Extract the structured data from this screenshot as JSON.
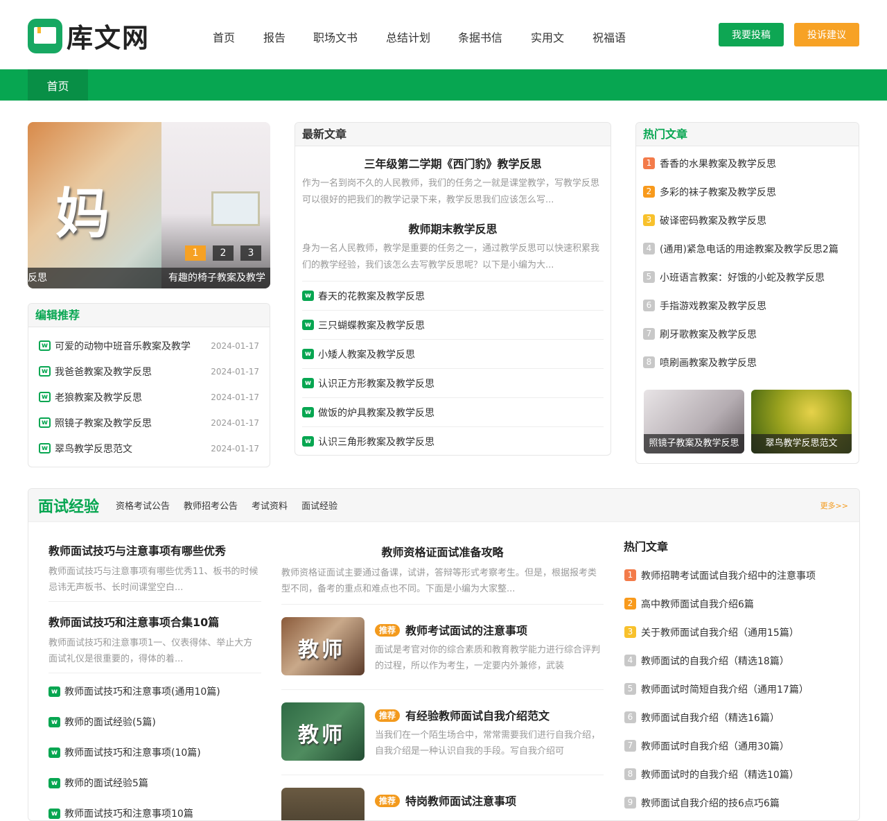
{
  "site": {
    "logo": "库文网"
  },
  "nav": [
    "首页",
    "报告",
    "职场文书",
    "总结计划",
    "条据书信",
    "实用文",
    "祝福语"
  ],
  "buttons": {
    "submit": "我要投稿",
    "feedback": "投诉建议"
  },
  "greenbar": {
    "active": "首页"
  },
  "slider": {
    "image_text": "妈",
    "captions": [
      "反思",
      "有趣的椅子教案及教学"
    ],
    "dots": [
      "1",
      "2",
      "3"
    ],
    "active_dot": 1
  },
  "editor": {
    "title": "编辑推荐",
    "items": [
      {
        "title": "可爱的动物中班音乐教案及教学",
        "date": "2024-01-17"
      },
      {
        "title": "我爸爸教案及教学反思",
        "date": "2024-01-17"
      },
      {
        "title": "老狼教案及教学反思",
        "date": "2024-01-17"
      },
      {
        "title": "照镜子教案及教学反思",
        "date": "2024-01-17"
      },
      {
        "title": "翠鸟教学反思范文",
        "date": "2024-01-17"
      }
    ]
  },
  "latest": {
    "title": "最新文章",
    "featured": [
      {
        "title": "三年级第二学期《西门豹》教学反思",
        "desc": "作为一名到岗不久的人民教师，我们的任务之一就是课堂教学，写教学反思可以很好的把我们的教学记录下来，教学反思我们应该怎么写..."
      },
      {
        "title": "教师期末教学反思",
        "desc": "身为一名人民教师，教学是重要的任务之一，通过教学反思可以快速积累我们的教学经验，我们该怎么去写教学反思呢？以下是小编为大..."
      }
    ],
    "items": [
      "春天的花教案及教学反思",
      "三只蝴蝶教案及教学反思",
      "小矮人教案及教学反思",
      "认识正方形教案及教学反思",
      "做饭的炉具教案及教学反思",
      "认识三角形教案及教学反思"
    ]
  },
  "hot": {
    "title": "热门文章",
    "items": [
      "香香的水果教案及教学反思",
      "多彩的袜子教案及教学反思",
      "破译密码教案及教学反思",
      "(通用)紧急电话的用途教案及教学反思2篇",
      "小班语言教案：好饿的小蛇及教学反思",
      "手指游戏教案及教学反思",
      "刷牙歌教案及教学反思",
      "喷刷画教案及教学反思"
    ],
    "thumbs": [
      "照镜子教案及教学反思",
      "翠鸟教学反思范文"
    ]
  },
  "interview": {
    "title": "面试经验",
    "tabs": [
      "资格考试公告",
      "教师招考公告",
      "考试资料",
      "面试经验"
    ],
    "more": "更多>>",
    "left_featured": [
      {
        "title": "教师面试技巧与注意事项有哪些优秀",
        "desc": "教师面试技巧与注意事项有哪些优秀11、板书的时候忌讳无声板书、长时间课堂空白..."
      },
      {
        "title": "教师面试技巧和注意事项合集10篇",
        "desc": "教师面试技巧和注意事项1一、仪表得体、举止大方面试礼仪是很重要的，得体的着..."
      }
    ],
    "left_items": [
      "教师面试技巧和注意事项(通用10篇)",
      "教师的面试经验(5篇)",
      "教师面试技巧和注意事项(10篇)",
      "教师的面试经验5篇",
      "教师面试技巧和注意事项10篇"
    ],
    "center_featured": {
      "title": "教师资格证面试准备攻略",
      "desc": "教师资格证面试主要通过备课，试讲，答辩等形式考察考生。但是，根据报考类型不同，备考的重点和难点也不同。下面是小编为大家整..."
    },
    "badge": "推荐",
    "center_items": [
      {
        "img_text": "教师",
        "title": "教师考试面试的注意事项",
        "desc": "面试是考官对你的综合素质和教育教学能力进行综合评判的过程，所以作为考生，一定要内外兼修，武装"
      },
      {
        "img_text": "教师",
        "title": "有经验教师面试自我介绍范文",
        "desc": "当我们在一个陌生场合中，常常需要我们进行自我介绍，自我介绍是一种认识自我的手段。写自我介绍可"
      },
      {
        "img_text": "",
        "title": "特岗教师面试注意事项",
        "desc": ""
      }
    ],
    "hot_title": "热门文章",
    "hot_items": [
      "教师招聘考试面试自我介绍中的注意事项",
      "高中教师面试自我介绍6篇",
      "关于教师面试自我介绍（通用15篇）",
      "教师面试的自我介绍（精选18篇）",
      "教师面试时简短自我介绍（通用17篇）",
      "教师面试自我介绍（精选16篇）",
      "教师面试时自我介绍（通用30篇）",
      "教师面试时的自我介绍（精选10篇）",
      "教师面试自我介绍的技6点巧6篇"
    ]
  },
  "colors": {
    "green": "#07a651",
    "orange": "#f39a1d",
    "rank1": "#f37b4a",
    "rank2": "#f89a1c",
    "rank3": "#f8c12c",
    "rank_other": "#c8c8c8"
  }
}
